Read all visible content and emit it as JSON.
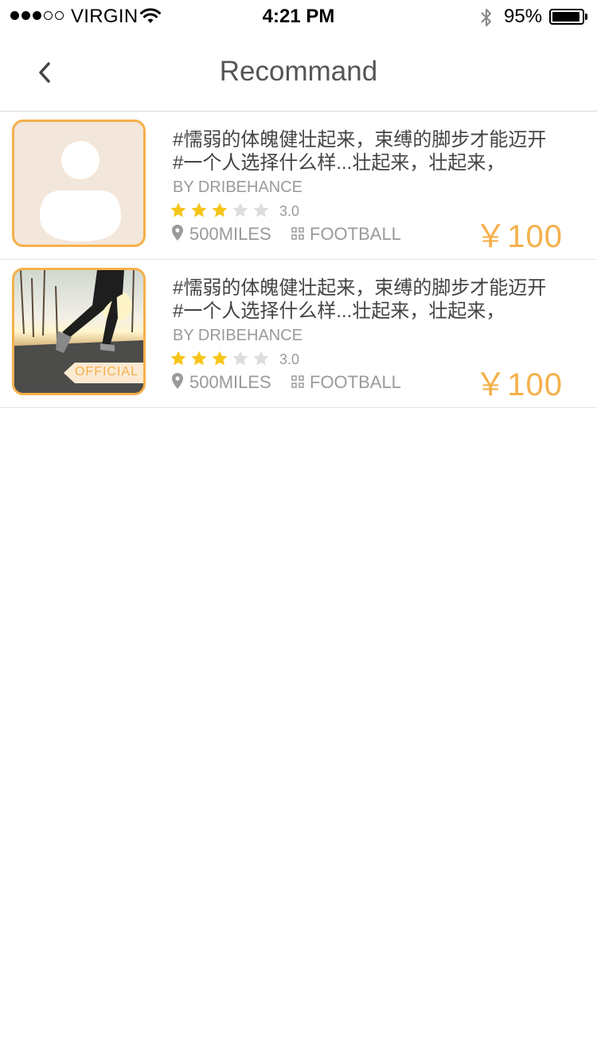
{
  "status_bar": {
    "carrier": "VIRGIN",
    "time": "4:21 PM",
    "battery_percent": "95%",
    "battery_level": 0.95,
    "signal_bars_filled": 3,
    "signal_bars_total": 5
  },
  "nav": {
    "title": "Recommand",
    "back_icon": "chevron-left-icon"
  },
  "colors": {
    "accent": "#f5b04a",
    "star_filled": "#f5c518",
    "star_empty": "#dddddd",
    "meta_text": "#9a9a9a"
  },
  "items": [
    {
      "title_line1": "#懦弱的体魄健壮起来，束缚的脚步才能迈开",
      "title_line2": "#一个人选择什么样...壮起来，壮起来，",
      "author": "BY DRIBEHANCE",
      "rating_value": 3,
      "rating_text": "3.0",
      "distance": "500MILES",
      "category": "FOOTBALL",
      "price": "￥100",
      "thumbnail": "avatar-placeholder-icon",
      "badge": ""
    },
    {
      "title_line1": "#懦弱的体魄健壮起来，束缚的脚步才能迈开",
      "title_line2": "#一个人选择什么样...壮起来，壮起来，",
      "author": "BY DRIBEHANCE",
      "rating_value": 3,
      "rating_text": "3.0",
      "distance": "500MILES",
      "category": "FOOTBALL",
      "price": "￥100",
      "thumbnail": "runner-photo",
      "badge": "OFFICIAL"
    }
  ]
}
